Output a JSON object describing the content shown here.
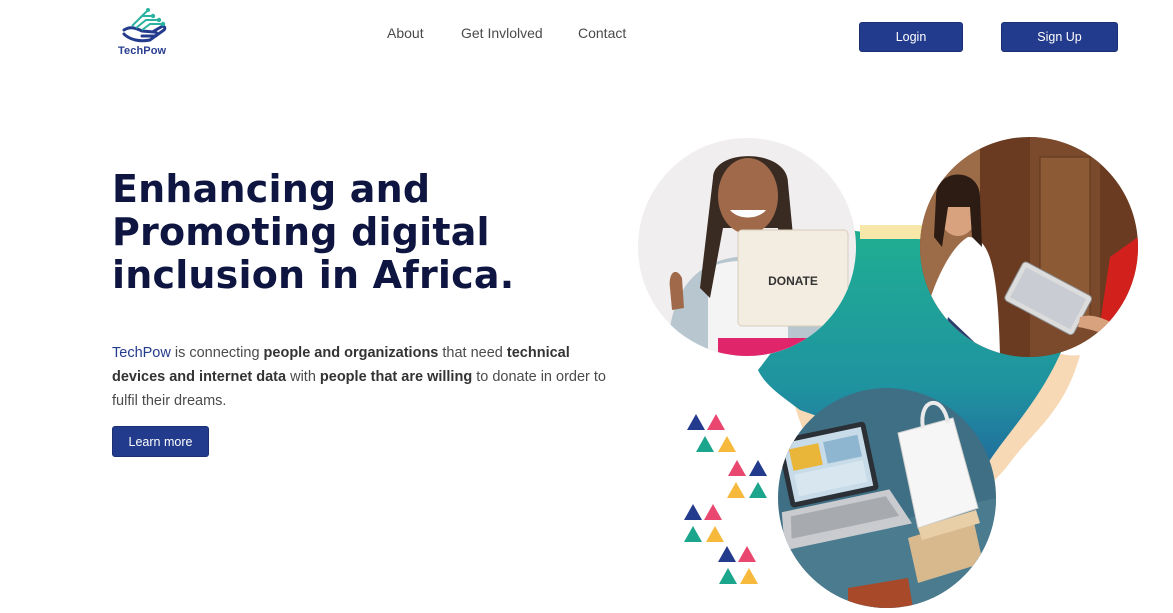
{
  "header": {
    "logo_text": "TechPow",
    "nav": [
      "About",
      "Get Invlolved",
      "Contact"
    ],
    "login_label": "Login",
    "signup_label": "Sign Up"
  },
  "hero": {
    "title_lines": [
      "Enhancing and",
      "Promoting digital",
      "inclusion in Africa."
    ],
    "description": {
      "brand": "TechPow",
      "t1": " is connecting ",
      "b1": "people and organizations",
      "t2": " that need ",
      "b2": "technical devices and internet data",
      "t3": " with ",
      "b3": "people that are willing",
      "t4": " to donate in order to fulfil their dreams."
    },
    "cta_label": "Learn more"
  },
  "images": {
    "donate_box_text": "DONATE"
  },
  "colors": {
    "primary": "#233b8c",
    "heading": "#0d1540",
    "teal": "#1faa93",
    "triangle_navy": "#233b8c",
    "triangle_pink": "#e9476f",
    "triangle_teal": "#1aa58c",
    "triangle_yellow": "#f6b93b"
  }
}
